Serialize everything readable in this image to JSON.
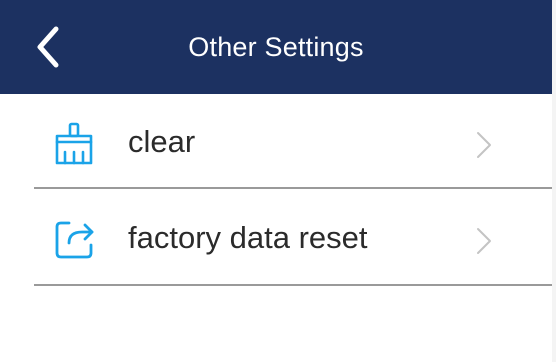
{
  "header": {
    "title": "Other Settings",
    "back_icon": "chevron-left-icon",
    "background_color": "#1c3161"
  },
  "settings": {
    "items": [
      {
        "label": "clear",
        "icon": "broom-icon",
        "trailing_icon": "chevron-right-icon"
      },
      {
        "label": "factory data reset",
        "icon": "reset-export-icon",
        "trailing_icon": "chevron-right-icon"
      }
    ]
  },
  "colors": {
    "accent": "#1aa3e8",
    "text": "#2b2b2b",
    "divider": "#9a9a9a",
    "chevron": "#c4c4c4"
  }
}
